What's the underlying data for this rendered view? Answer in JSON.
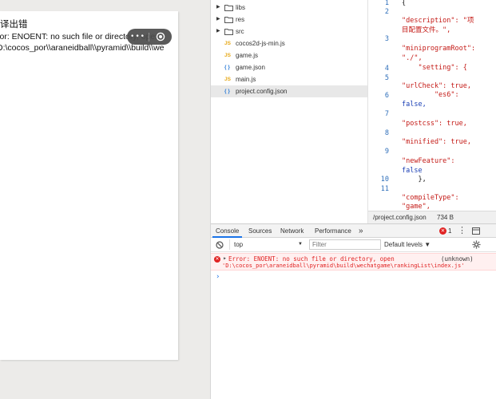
{
  "simulator": {
    "error_title": "译出错",
    "error_line1": "ror: ENOENT: no such file or directory, open",
    "error_line2": "D:\\cocos_por\\\\araneidball\\\\pyramid\\\\build\\\\we",
    "capsule_more": "•••"
  },
  "file_tree": [
    {
      "name": "libs",
      "kind": "folder"
    },
    {
      "name": "res",
      "kind": "folder"
    },
    {
      "name": "src",
      "kind": "folder"
    },
    {
      "name": "cocos2d-js-min.js",
      "kind": "js",
      "badge": "JS"
    },
    {
      "name": "game.js",
      "kind": "js",
      "badge": "JS"
    },
    {
      "name": "game.json",
      "kind": "json",
      "badge": "{ }"
    },
    {
      "name": "main.js",
      "kind": "js",
      "badge": "JS"
    },
    {
      "name": "project.config.json",
      "kind": "json",
      "badge": "{ }",
      "selected": true
    }
  ],
  "code": {
    "line_numbers": [
      "1",
      "2",
      "3",
      "4",
      "5",
      "6",
      "7",
      "8",
      "9",
      "10",
      "11"
    ],
    "lines": [
      "{",
      "\"description\": \"项",
      "目配置文件。\",",
      "\"miniprogramRoot\":",
      "\"./\",",
      "    \"setting\": {",
      "\"urlCheck\": true,",
      "        \"es6\":",
      "false,",
      "\"postcss\": true,",
      "\"minified\": true,",
      "\"newFeature\":",
      "false",
      "    },",
      "\"compileType\":",
      "\"game\","
    ]
  },
  "status_bar": {
    "path": "/project.config.json",
    "size": "734 B"
  },
  "devtools": {
    "tabs": [
      "Console",
      "Sources",
      "Network",
      "Performance"
    ],
    "more_tabs": "»",
    "error_count": "1",
    "context": "top",
    "filter_placeholder": "Filter",
    "levels": "Default levels ▼"
  },
  "console": {
    "error_line1": "Error: ENOENT: no such file or directory, open",
    "error_line2": "'D:\\cocos_por\\araneidball\\pyramid\\build\\wechatgame\\rankingList\\index.js'",
    "error_source": "(unknown)",
    "prompt": "›"
  }
}
